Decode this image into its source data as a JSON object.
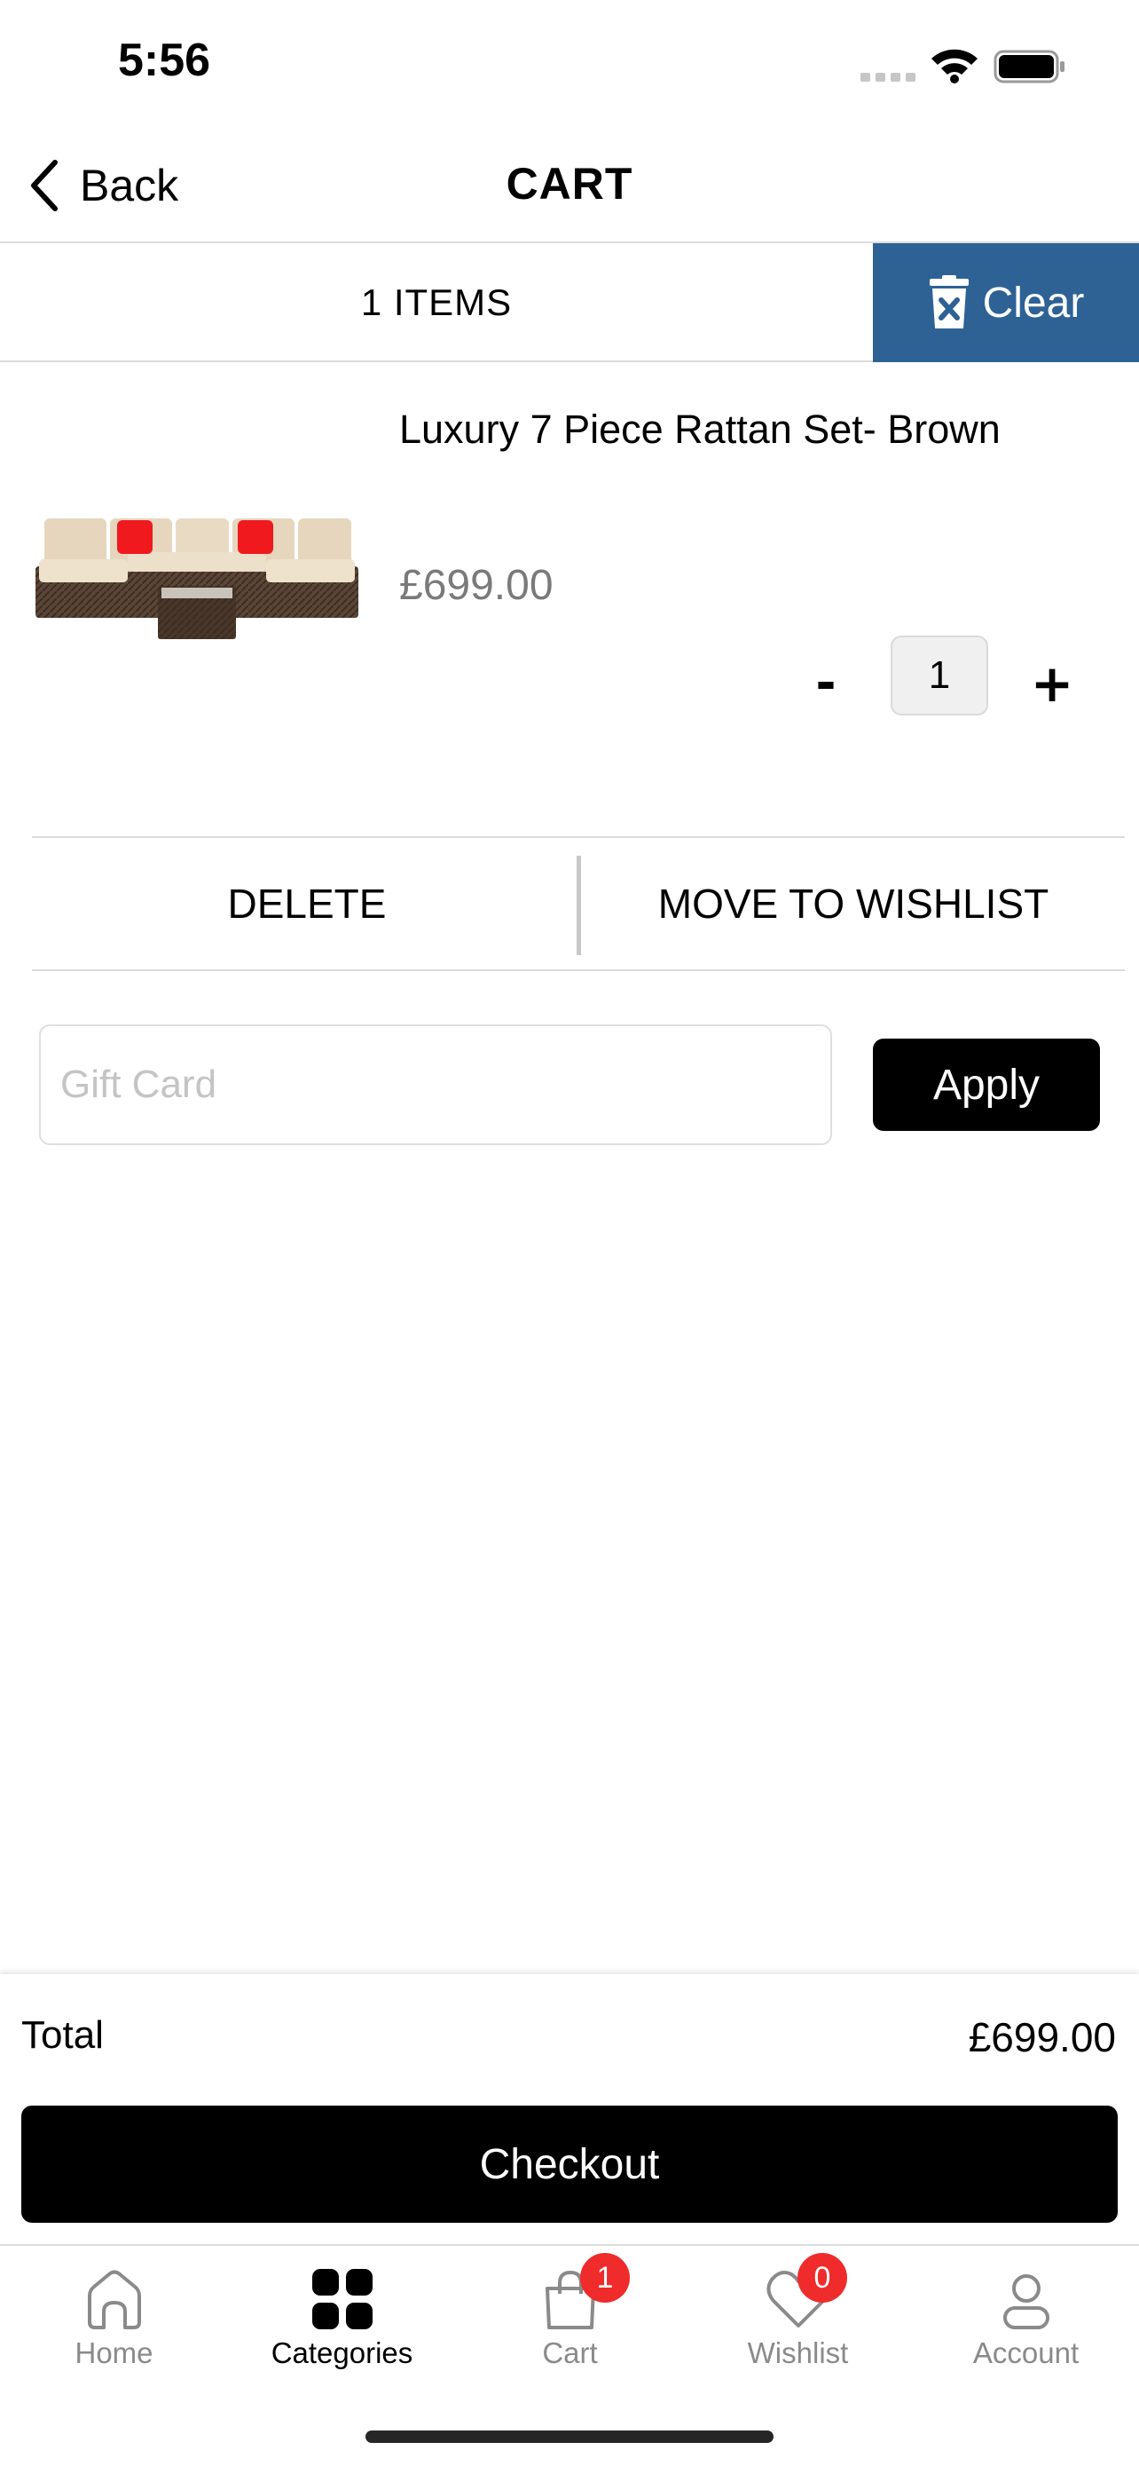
{
  "status_bar": {
    "time": "5:56"
  },
  "navbar": {
    "back_label": "Back",
    "title": "CART"
  },
  "items_header": {
    "count_label": "1 ITEMS",
    "clear_label": "Clear",
    "clear_color": "#2e6295"
  },
  "cart_items": [
    {
      "name": "Luxury 7 Piece Rattan Set- Brown",
      "price": "£699.00",
      "quantity": "1",
      "minus_label": "-",
      "plus_label": "+"
    }
  ],
  "actions": {
    "delete_label": "DELETE",
    "wishlist_label": "MOVE TO WISHLIST"
  },
  "gift_card": {
    "placeholder": "Gift Card",
    "apply_label": "Apply"
  },
  "summary": {
    "total_label": "Total",
    "total_value": "£699.00",
    "checkout_label": "Checkout"
  },
  "tab_bar": {
    "tabs": [
      {
        "label": "Home",
        "icon": "home-icon"
      },
      {
        "label": "Categories",
        "icon": "grid-icon",
        "active": true
      },
      {
        "label": "Cart",
        "icon": "bag-icon",
        "badge": "1"
      },
      {
        "label": "Wishlist",
        "icon": "heart-icon",
        "badge": "0"
      },
      {
        "label": "Account",
        "icon": "user-icon"
      }
    ],
    "badge_color": "#ef2b2b"
  }
}
